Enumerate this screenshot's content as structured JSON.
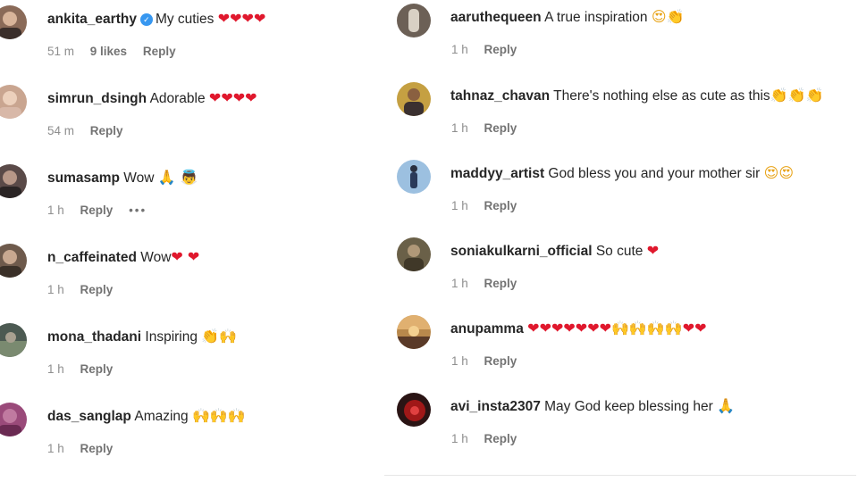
{
  "comments_left": [
    {
      "username": "ankita_earthy",
      "verified": true,
      "text": "My cuties",
      "emoji": "❤❤❤❤",
      "time": "51 m",
      "likes": "9 likes",
      "reply": "Reply",
      "more": "",
      "avatar_color": "#8a6a58"
    },
    {
      "username": "simrun_dsingh",
      "verified": false,
      "text": "Adorable",
      "emoji": "❤❤❤❤",
      "time": "54 m",
      "likes": "",
      "reply": "Reply",
      "more": "",
      "avatar_color": "#c9a590"
    },
    {
      "username": "sumasamp",
      "verified": false,
      "text": "Wow",
      "emoji": "🙏 👼",
      "time": "1 h",
      "likes": "",
      "reply": "Reply",
      "more": "•••",
      "avatar_color": "#5a4a48"
    },
    {
      "username": "n_caffeinated",
      "verified": false,
      "text": "Wow",
      "emoji": "❤ ❤",
      "time": "1 h",
      "likes": "",
      "reply": "Reply",
      "more": "",
      "avatar_color": "#6e5a4c"
    },
    {
      "username": "mona_thadani",
      "verified": false,
      "text": "Inspiring",
      "emoji": "👏🙌",
      "time": "1 h",
      "likes": "",
      "reply": "Reply",
      "more": "",
      "avatar_color": "#4c5a52"
    },
    {
      "username": "das_sanglap",
      "verified": false,
      "text": "Amazing",
      "emoji": "🙌🙌🙌",
      "time": "1 h",
      "likes": "",
      "reply": "Reply",
      "more": "",
      "avatar_color": "#9a4a7a"
    }
  ],
  "comments_right": [
    {
      "username": "aaruthequeen",
      "verified": false,
      "text": "A true inspiration",
      "emoji": "😍👏",
      "time": "1 h",
      "likes": "",
      "reply": "Reply",
      "more": "",
      "avatar_color": "#6c6056"
    },
    {
      "username": "tahnaz_chavan",
      "verified": false,
      "text": "There's nothing else as cute as this",
      "emoji": "👏👏👏",
      "time": "1 h",
      "likes": "",
      "reply": "Reply",
      "more": "",
      "avatar_color": "#c5a042"
    },
    {
      "username": "maddyy_artist",
      "verified": false,
      "text": "God bless you and your mother sir",
      "emoji": "😍😍",
      "time": "1 h",
      "likes": "",
      "reply": "Reply",
      "more": "",
      "avatar_color": "#9cc0e0"
    },
    {
      "username": "soniakulkarni_official",
      "verified": false,
      "text": "So cute",
      "emoji": "❤",
      "time": "1 h",
      "likes": "",
      "reply": "Reply",
      "more": "",
      "avatar_color": "#6a6048"
    },
    {
      "username": "anupamma",
      "verified": false,
      "text": "",
      "emoji": "❤❤❤❤❤❤❤🙌🙌🙌🙌❤❤",
      "time": "1 h",
      "likes": "",
      "reply": "Reply",
      "more": "",
      "avatar_color": "#b8884c"
    },
    {
      "username": "avi_insta2307",
      "verified": false,
      "text": "May God keep blessing her",
      "emoji": "🙏",
      "time": "1 h",
      "likes": "",
      "reply": "Reply",
      "more": "",
      "avatar_color": "#a01818"
    }
  ],
  "colors": {
    "heart": "#e0182d",
    "verified": "#3797f0",
    "meta": "#8e8e8e"
  }
}
